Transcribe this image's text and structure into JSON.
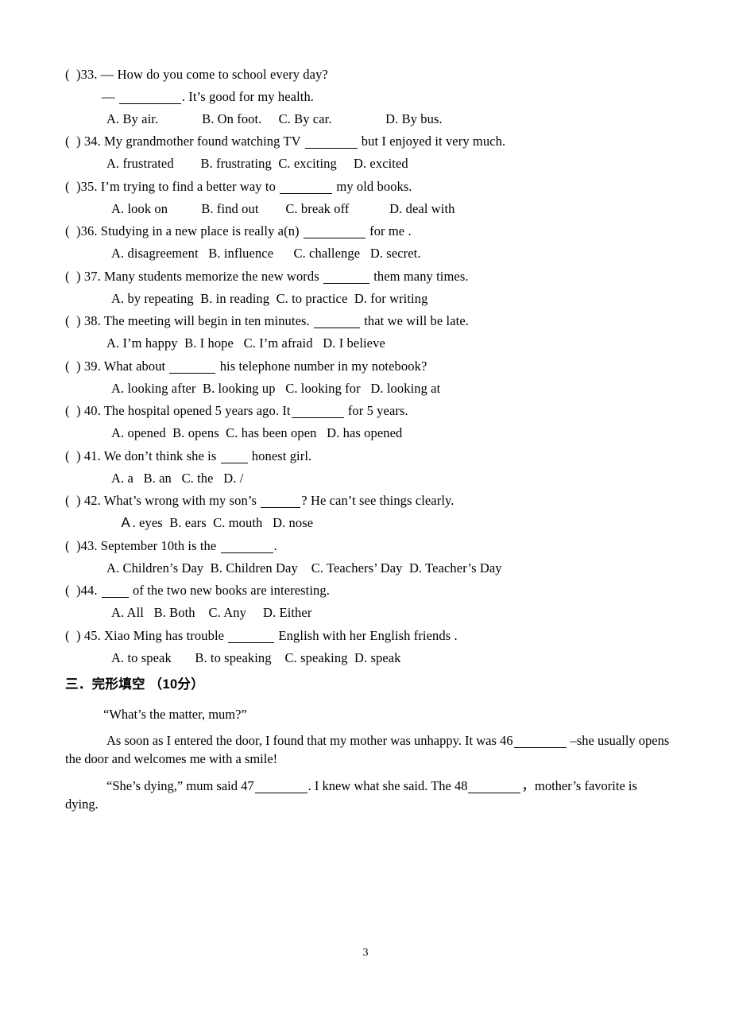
{
  "document": {
    "page_number": "3",
    "dash_em": "—",
    "paren_open": "(",
    "paren_close": ")"
  },
  "questions": [
    {
      "id": "q33",
      "marker": "(  )33.",
      "stem": "(  )33. — How do you come to school every day?",
      "stem_pre": "(  )33. — How do you come to school every day?",
      "sub_pre": "— ",
      "sub_post": ". It’s good for my health.",
      "options_line": "A. By air.             B. On foot.     C. By car.                D. By bus.",
      "options": [
        {
          "key": "A",
          "text": "By air."
        },
        {
          "key": "B",
          "text": "On foot."
        },
        {
          "key": "C",
          "text": "By car."
        },
        {
          "key": "D",
          "text": "By bus."
        }
      ]
    },
    {
      "id": "q34",
      "marker": "(  ) 34.",
      "stem_pre": "(  ) 34. My grandmother found watching TV ",
      "stem_post": " but I enjoyed it very much.",
      "options_line": "A. frustrated        B. frustrating  C. exciting     D. excited",
      "options": [
        {
          "key": "A",
          "text": "frustrated"
        },
        {
          "key": "B",
          "text": "frustrating"
        },
        {
          "key": "C",
          "text": "exciting"
        },
        {
          "key": "D",
          "text": "excited"
        }
      ]
    },
    {
      "id": "q35",
      "marker": "(  )35.",
      "stem_pre": "(  )35. I’m trying to find a better way to ",
      "stem_post": " my old books.",
      "options_line": "A. look on          B. find out        C. break off            D. deal with",
      "options": [
        {
          "key": "A",
          "text": "look on"
        },
        {
          "key": "B",
          "text": "find out"
        },
        {
          "key": "C",
          "text": "break off"
        },
        {
          "key": "D",
          "text": "deal with"
        }
      ]
    },
    {
      "id": "q36",
      "marker": "(  )36.",
      "stem_pre": "(  )36. Studying in a new place is really a(n) ",
      "stem_post": " for me .",
      "options_line": "A. disagreement   B. influence      C. challenge   D. secret.",
      "options": [
        {
          "key": "A",
          "text": "disagreement"
        },
        {
          "key": "B",
          "text": "influence"
        },
        {
          "key": "C",
          "text": "challenge"
        },
        {
          "key": "D",
          "text": "secret."
        }
      ]
    },
    {
      "id": "q37",
      "marker": "(  ) 37.",
      "stem_pre": "(  ) 37. Many students memorize the new words ",
      "stem_post": " them many times.",
      "options_line": "A. by repeating  B. in reading  C. to practice  D. for writing",
      "options": [
        {
          "key": "A",
          "text": "by repeating"
        },
        {
          "key": "B",
          "text": "in reading"
        },
        {
          "key": "C",
          "text": "to practice"
        },
        {
          "key": "D",
          "text": "for writing"
        }
      ]
    },
    {
      "id": "q38",
      "marker": "(  ) 38.",
      "stem_pre": "(  ) 38. The meeting will begin in ten minutes. ",
      "stem_post": " that we will be late.",
      "options_line": "A. I’m happy  B. I hope   C. I’m afraid   D. I believe",
      "options": [
        {
          "key": "A",
          "text": "I’m happy"
        },
        {
          "key": "B",
          "text": "I hope"
        },
        {
          "key": "C",
          "text": "I’m afraid"
        },
        {
          "key": "D",
          "text": "I believe"
        }
      ]
    },
    {
      "id": "q39",
      "marker": "(  ) 39.",
      "stem_pre": "(  ) 39. What about ",
      "stem_post": " his telephone number in my notebook?",
      "options_line": "A. looking after  B. looking up   C. looking for   D. looking at",
      "options": [
        {
          "key": "A",
          "text": "looking after"
        },
        {
          "key": "B",
          "text": "looking up"
        },
        {
          "key": "C",
          "text": "looking for"
        },
        {
          "key": "D",
          "text": "looking at"
        }
      ]
    },
    {
      "id": "q40",
      "marker": "(  ) 40.",
      "stem_pre": "(  ) 40. The hospital opened 5 years ago. It",
      "stem_post": " for 5 years.",
      "options_line": "A. opened  B. opens  C. has been open   D. has opened",
      "options": [
        {
          "key": "A",
          "text": "opened"
        },
        {
          "key": "B",
          "text": "opens"
        },
        {
          "key": "C",
          "text": "has been open"
        },
        {
          "key": "D",
          "text": "has opened"
        }
      ]
    },
    {
      "id": "q41",
      "marker": "(  ) 41.",
      "stem_pre": "(  ) 41. We don’t think she is ",
      "stem_post": " honest girl.",
      "options_line": "A. a   B. an   C. the   D. /",
      "options": [
        {
          "key": "A",
          "text": "a"
        },
        {
          "key": "B",
          "text": "an"
        },
        {
          "key": "C",
          "text": "the"
        },
        {
          "key": "D",
          "text": "/"
        }
      ]
    },
    {
      "id": "q42",
      "marker": "(  ) 42.",
      "stem_pre": "(  ) 42. What’s wrong with my son’s ",
      "stem_post": "? He can’t see things clearly.",
      "options_line": "Ａ. eyes  B. ears  C. mouth   D. nose",
      "options": [
        {
          "key": "Ａ",
          "text": "eyes"
        },
        {
          "key": "B",
          "text": "ears"
        },
        {
          "key": "C",
          "text": "mouth"
        },
        {
          "key": "D",
          "text": "nose"
        }
      ]
    },
    {
      "id": "q43",
      "marker": "(  )43.",
      "stem_pre": "(  )43. September 10th is the ",
      "stem_post": ".",
      "options_line": "A. Children’s Day  B. Children Day    C. Teachers’ Day  D. Teacher’s Day",
      "options": [
        {
          "key": "A",
          "text": "Children’s Day"
        },
        {
          "key": "B",
          "text": "Children Day"
        },
        {
          "key": "C",
          "text": "Teachers’ Day"
        },
        {
          "key": "D",
          "text": "Teacher’s Day"
        }
      ]
    },
    {
      "id": "q44",
      "marker": "(  )44.",
      "stem_pre": "(  )44. ",
      "stem_post": " of the two new books are interesting.",
      "options_line": "A. All   B. Both    C. Any     D. Either",
      "options": [
        {
          "key": "A",
          "text": "All"
        },
        {
          "key": "B",
          "text": "Both"
        },
        {
          "key": "C",
          "text": "Any"
        },
        {
          "key": "D",
          "text": "Either"
        }
      ]
    },
    {
      "id": "q45",
      "marker": "(  ) 45.",
      "stem_pre": "(  ) 45. Xiao Ming has trouble ",
      "stem_post": " English with her English friends .",
      "options_line": "A. to speak       B. to speaking    C. speaking  D. speak",
      "options": [
        {
          "key": "A",
          "text": "to speak"
        },
        {
          "key": "B",
          "text": "to speaking"
        },
        {
          "key": "C",
          "text": "speaking"
        },
        {
          "key": "D",
          "text": "speak"
        }
      ]
    }
  ],
  "cloze_section": {
    "heading": "三．完形填空 （10分）",
    "line_quote": "“What’s the matter, mum?”",
    "para1_pre": "As soon as I entered the door, I found that my mother was unhappy. It was 46",
    "para1_post": " –she usually opens the door and welcomes me with a smile!",
    "para2_pre": "“She’s dying,” mum said 47",
    "para2_mid": ". I knew what she said. The 48",
    "para2_post": "，mother’s favorite is dying."
  }
}
